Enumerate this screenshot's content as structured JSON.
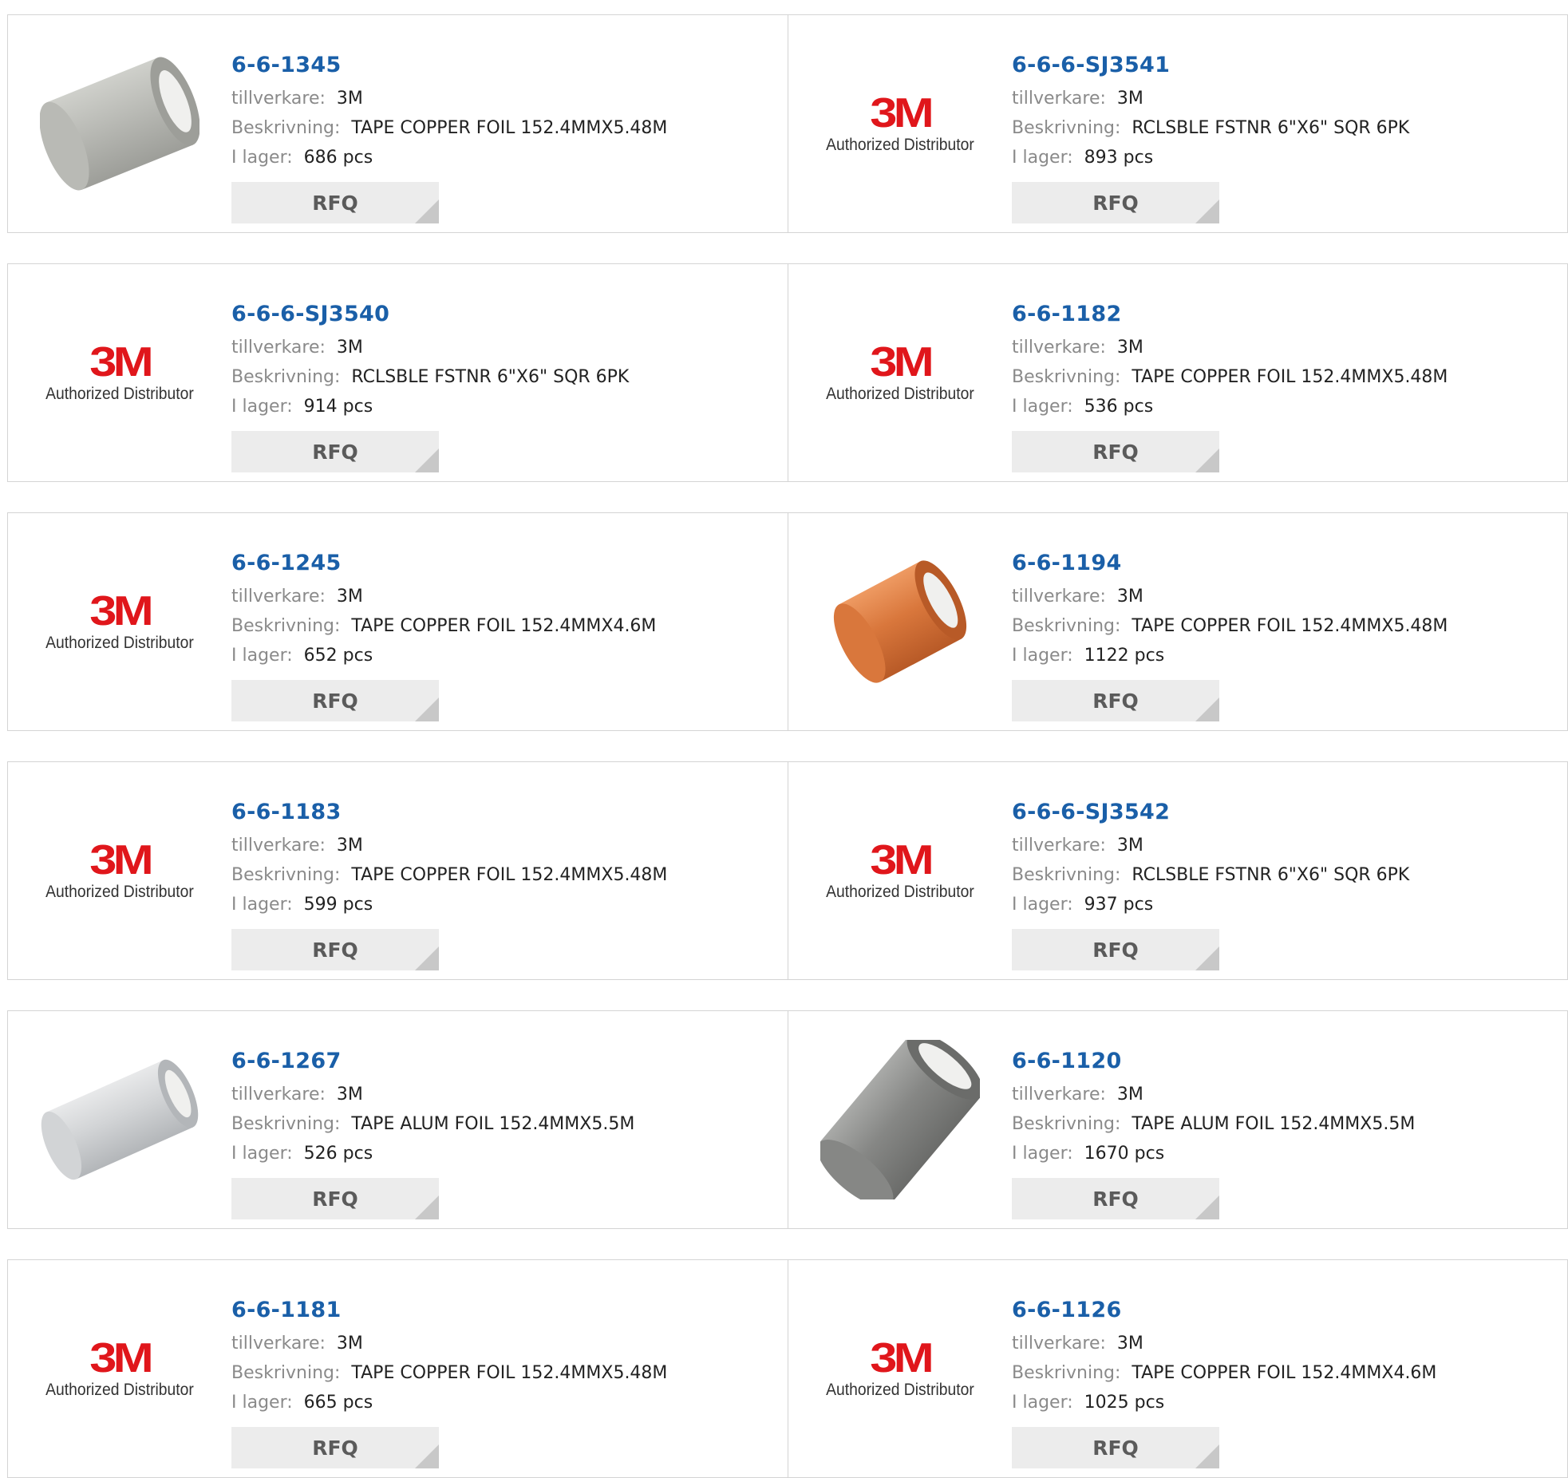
{
  "labels": {
    "manufacturer": "tillverkare:",
    "description": "Beskrivning:",
    "stock": "I lager:",
    "rfq": "RFQ"
  },
  "brand": {
    "logo_text": "3M",
    "tagline": "Authorized Distributor",
    "logo_color": "#e0161b"
  },
  "colors": {
    "part_link": "#1a5fa8",
    "label_gray": "#8a8a8a",
    "button_bg": "#ececec"
  },
  "products": [
    {
      "part": "6-6-1345",
      "manufacturer": "3M",
      "description": "TAPE COPPER FOIL 152.4MMX5.48M",
      "stock": "686 pcs",
      "image": "silver-tape-roll"
    },
    {
      "part": "6-6-6-SJ3541",
      "manufacturer": "3M",
      "description": "RCLSBLE FSTNR 6\"X6\" SQR 6PK",
      "stock": "893 pcs",
      "image": "3m-logo"
    },
    {
      "part": "6-6-6-SJ3540",
      "manufacturer": "3M",
      "description": "RCLSBLE FSTNR 6\"X6\" SQR 6PK",
      "stock": "914 pcs",
      "image": "3m-logo"
    },
    {
      "part": "6-6-1182",
      "manufacturer": "3M",
      "description": "TAPE COPPER FOIL 152.4MMX5.48M",
      "stock": "536 pcs",
      "image": "3m-logo"
    },
    {
      "part": "6-6-1245",
      "manufacturer": "3M",
      "description": "TAPE COPPER FOIL 152.4MMX4.6M",
      "stock": "652 pcs",
      "image": "3m-logo"
    },
    {
      "part": "6-6-1194",
      "manufacturer": "3M",
      "description": "TAPE COPPER FOIL 152.4MMX5.48M",
      "stock": "1122 pcs",
      "image": "copper-tape-roll"
    },
    {
      "part": "6-6-1183",
      "manufacturer": "3M",
      "description": "TAPE COPPER FOIL 152.4MMX5.48M",
      "stock": "599 pcs",
      "image": "3m-logo"
    },
    {
      "part": "6-6-6-SJ3542",
      "manufacturer": "3M",
      "description": "RCLSBLE FSTNR 6\"X6\" SQR 6PK",
      "stock": "937 pcs",
      "image": "3m-logo"
    },
    {
      "part": "6-6-1267",
      "manufacturer": "3M",
      "description": "TAPE ALUM FOIL 152.4MMX5.5M",
      "stock": "526 pcs",
      "image": "clear-tape-roll"
    },
    {
      "part": "6-6-1120",
      "manufacturer": "3M",
      "description": "TAPE ALUM FOIL 152.4MMX5.5M",
      "stock": "1670 pcs",
      "image": "gray-tape-roll"
    },
    {
      "part": "6-6-1181",
      "manufacturer": "3M",
      "description": "TAPE COPPER FOIL 152.4MMX5.48M",
      "stock": "665 pcs",
      "image": "3m-logo"
    },
    {
      "part": "6-6-1126",
      "manufacturer": "3M",
      "description": "TAPE COPPER FOIL 152.4MMX4.6M",
      "stock": "1025 pcs",
      "image": "3m-logo"
    }
  ]
}
